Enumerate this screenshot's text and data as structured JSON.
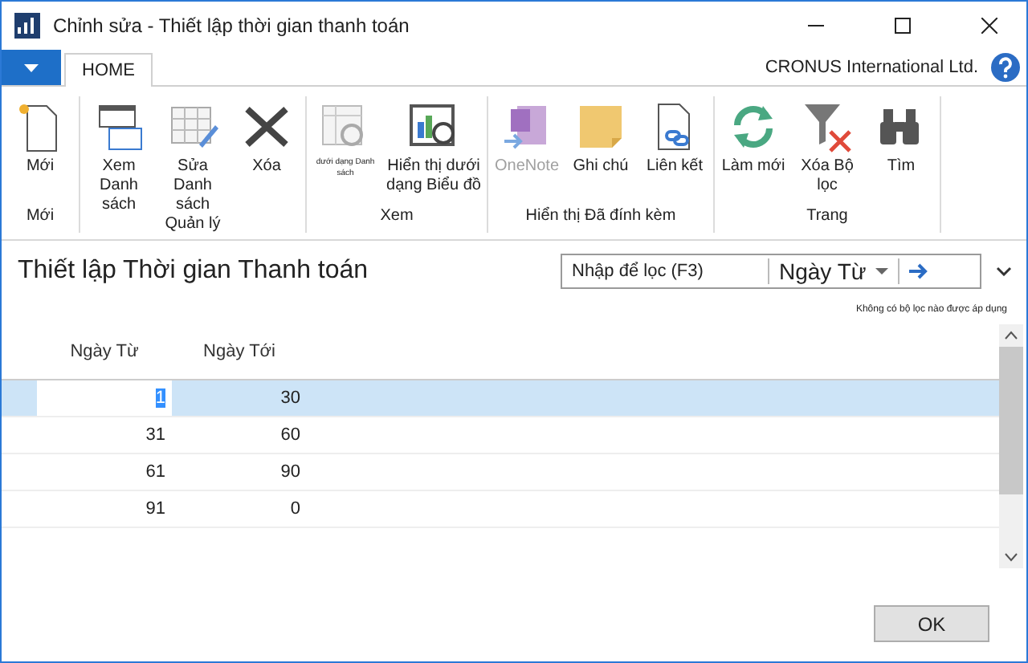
{
  "window": {
    "title": "Chỉnh sửa - Thiết lập thời gian thanh toán"
  },
  "tabs": [
    {
      "label": "HOME",
      "selected": true
    }
  ],
  "company": "CRONUS International Ltd.",
  "ribbon": [
    {
      "label": "Mới",
      "buttons": [
        {
          "kind": "new",
          "label": "Mới",
          "disabled": false
        }
      ]
    },
    {
      "label": "Quản lý",
      "buttons": [
        {
          "kind": "view-list",
          "label": "Xem Danh sách",
          "disabled": false
        },
        {
          "kind": "edit-list",
          "label": "Sửa Danh sách",
          "disabled": false
        },
        {
          "kind": "delete",
          "label": "Xóa",
          "disabled": false
        }
      ]
    },
    {
      "label": "Xem",
      "buttons": [
        {
          "kind": "show-list",
          "label": "dưới dạng Danh sách",
          "disabled": false
        },
        {
          "kind": "show-chart",
          "label": "Hiển thị dưới dạng Biểu đồ",
          "disabled": false
        }
      ]
    },
    {
      "label": "Hiển thị Đã đính kèm",
      "buttons": [
        {
          "kind": "onenote",
          "label": "OneNote",
          "disabled": true
        },
        {
          "kind": "note",
          "label": "Ghi chú",
          "disabled": false
        },
        {
          "kind": "link",
          "label": "Liên kết",
          "disabled": false
        }
      ]
    },
    {
      "label": "Trang",
      "buttons": [
        {
          "kind": "refresh",
          "label": "Làm mới",
          "disabled": false
        },
        {
          "kind": "clear-filter",
          "label": "Xóa Bộ lọc",
          "disabled": false
        },
        {
          "kind": "find",
          "label": "Tìm",
          "disabled": false
        }
      ]
    }
  ],
  "page": {
    "title": "Thiết lập Thời gian Thanh toán"
  },
  "filter": {
    "placeholder": "Nhập để lọc (F3)",
    "field": "Ngày Từ",
    "status": "Không có bộ lọc nào được áp dụng"
  },
  "table": {
    "columns": [
      "Ngày Từ",
      "Ngày Tới"
    ],
    "rows": [
      {
        "cells": [
          "1",
          "30"
        ],
        "selected": true
      },
      {
        "cells": [
          "31",
          "60"
        ],
        "selected": false
      },
      {
        "cells": [
          "61",
          "90"
        ],
        "selected": false
      },
      {
        "cells": [
          "91",
          "0"
        ],
        "selected": false
      }
    ]
  },
  "buttons": [
    "OK"
  ]
}
